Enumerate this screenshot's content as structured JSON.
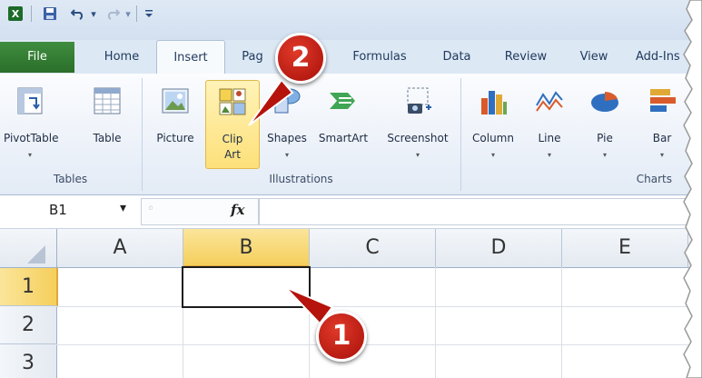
{
  "quick_access": {
    "app_icon": "excel-icon",
    "save_icon": "save-icon",
    "undo_icon": "undo-icon",
    "redo_icon": "redo-icon",
    "customize_icon": "customize-dropdown-icon"
  },
  "tabs": [
    {
      "label": "File"
    },
    {
      "label": "Home"
    },
    {
      "label": "Insert"
    },
    {
      "label": "Pag"
    },
    {
      "label": "Formulas"
    },
    {
      "label": "Data"
    },
    {
      "label": "Review"
    },
    {
      "label": "View"
    },
    {
      "label": "Add-Ins"
    }
  ],
  "ribbon": {
    "groups": {
      "tables": "Tables",
      "illustrations": "Illustrations",
      "charts": "Charts"
    },
    "buttons": {
      "pivottable": "PivotTable",
      "table": "Table",
      "picture": "Picture",
      "clipart_line1": "Clip",
      "clipart_line2": "Art",
      "shapes": "Shapes",
      "smartart": "SmartArt",
      "screenshot": "Screenshot",
      "column": "Column",
      "line": "Line",
      "pie": "Pie",
      "bar": "Bar"
    },
    "dropdown_glyph": "▾"
  },
  "formula_bar": {
    "name_box": "B1",
    "name_dropdown": "▾",
    "fx_label": "fx",
    "formula_value": ""
  },
  "grid": {
    "columns": [
      "A",
      "B",
      "C",
      "D",
      "E"
    ],
    "rows": [
      "1",
      "2",
      "3"
    ],
    "selected_cell": "B1"
  },
  "callouts": {
    "one": "1",
    "two": "2"
  },
  "colors": {
    "file_tab": "#2f7a2f",
    "selection_border": "#1c1c1c",
    "callout_red": "#c8170f",
    "clipart_highlight": "#fde07a"
  }
}
